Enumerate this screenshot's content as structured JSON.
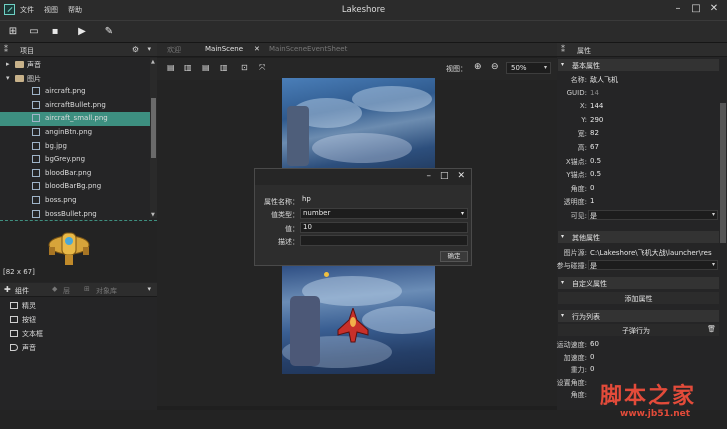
{
  "window": {
    "title": "Lakeshore"
  },
  "menu": [
    "文件",
    "视图",
    "帮助"
  ],
  "project": {
    "title": "项目"
  },
  "tree": [
    {
      "label": "声音",
      "type": "folder"
    },
    {
      "label": "图片",
      "type": "folder-open"
    },
    {
      "label": "aircraft.png",
      "type": "file"
    },
    {
      "label": "aircraftBullet.png",
      "type": "file"
    },
    {
      "label": "aircraft_small.png",
      "type": "file",
      "selected": true
    },
    {
      "label": "anginBtn.png",
      "type": "file"
    },
    {
      "label": "bg.jpg",
      "type": "file"
    },
    {
      "label": "bgGrey.png",
      "type": "file"
    },
    {
      "label": "bloodBar.png",
      "type": "file"
    },
    {
      "label": "bloodBarBg.png",
      "type": "file"
    },
    {
      "label": "boss.png",
      "type": "file"
    },
    {
      "label": "bossBullet.png",
      "type": "file"
    }
  ],
  "preview": {
    "size": "[82 x 67]"
  },
  "components": {
    "tab_components": "组件",
    "tab_layers": "层",
    "tab_objects": "对象库",
    "items": [
      "精灵",
      "按钮",
      "文本框",
      "声音"
    ]
  },
  "tabs": [
    "欢迎",
    "MainScene",
    "MainSceneEventSheet"
  ],
  "scene": {
    "view_label": "视图：",
    "zoom": "50%"
  },
  "dialog": {
    "rows": [
      {
        "label": "属性名称：",
        "value": "hp"
      },
      {
        "label": "值类型：",
        "value": "number"
      },
      {
        "label": "值：",
        "value": "10"
      },
      {
        "label": "描述：",
        "value": ""
      }
    ],
    "ok": "确定"
  },
  "properties": {
    "title": "属性",
    "basic_title": "基本属性",
    "basic": [
      {
        "k": "名称:",
        "v": "敌人飞机"
      },
      {
        "k": "GUID:",
        "v": "14",
        "dim": true
      },
      {
        "k": "X:",
        "v": "144"
      },
      {
        "k": "Y:",
        "v": "290"
      },
      {
        "k": "宽:",
        "v": "82"
      },
      {
        "k": "高:",
        "v": "67"
      },
      {
        "k": "X锚点:",
        "v": "0.5"
      },
      {
        "k": "Y锚点:",
        "v": "0.5"
      },
      {
        "k": "角度:",
        "v": "0"
      },
      {
        "k": "透明度:",
        "v": "1"
      },
      {
        "k": "可见:",
        "v": "是"
      }
    ],
    "other_title": "其他属性",
    "other": [
      {
        "k": "图片源:",
        "v": "C:\\Lakeshore\\飞机大战\\launcher\\res"
      },
      {
        "k": "参与碰撞:",
        "v": "是"
      }
    ],
    "custom_title": "自定义属性",
    "add_prop": "添加属性",
    "behavior_title": "行为列表",
    "behavior_sub": "子弹行为",
    "behavior": [
      {
        "k": "运动速度:",
        "v": "60"
      },
      {
        "k": "加速度:",
        "v": "0"
      },
      {
        "k": "重力:",
        "v": "0"
      },
      {
        "k": "设置角度:",
        "v": ""
      },
      {
        "k": "角度:",
        "v": ""
      }
    ]
  },
  "watermark": {
    "main": "脚本之家",
    "url": "www.jb51.net"
  }
}
